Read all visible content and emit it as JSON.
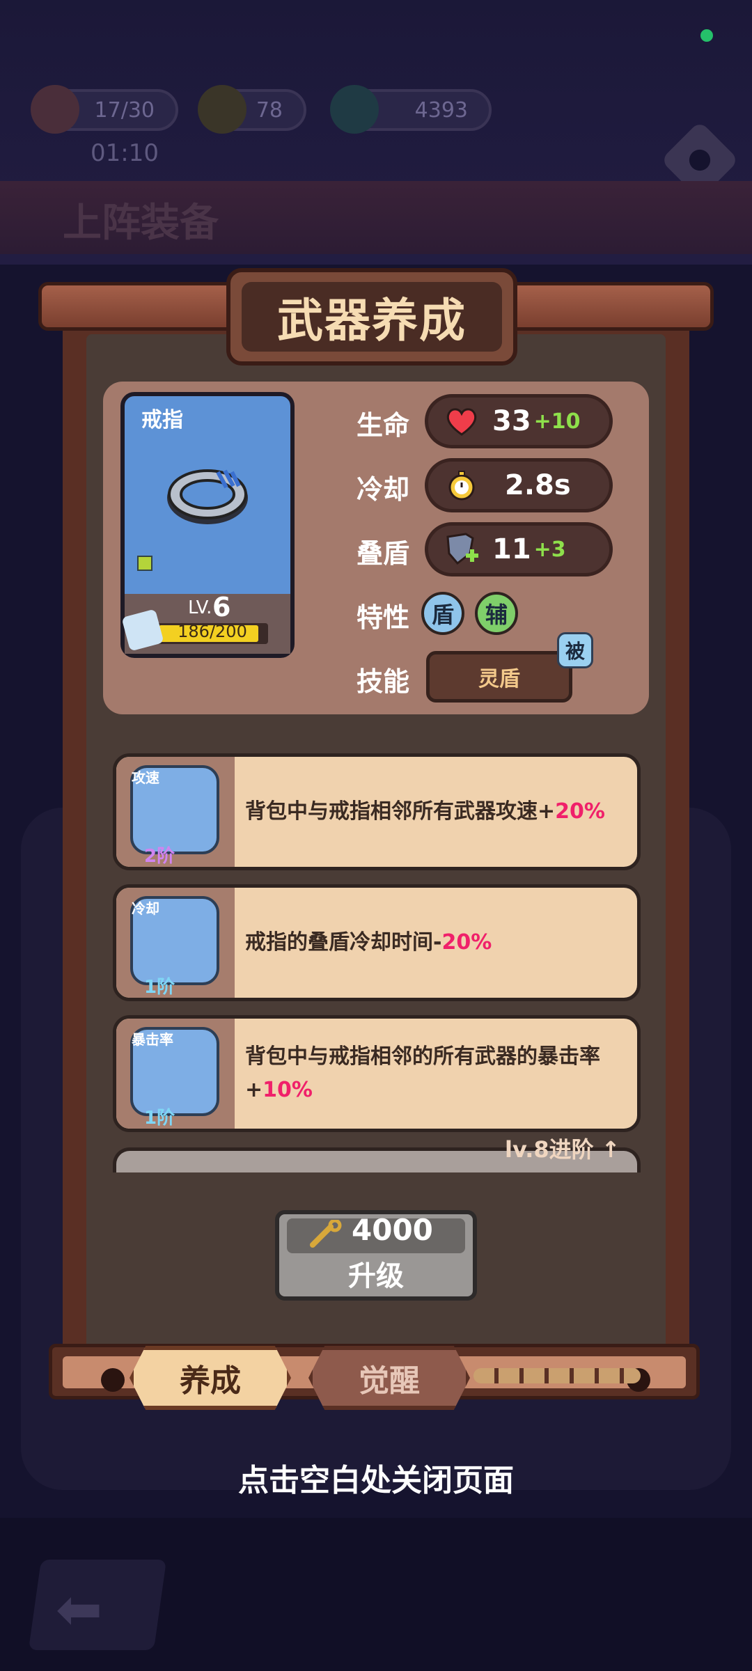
{
  "resources": {
    "stamina": "17/30",
    "keys": "78",
    "gems": "4393",
    "timer": "01:10"
  },
  "background": {
    "title": "上阵装备"
  },
  "panel": {
    "title": "武器养成"
  },
  "weapon": {
    "name": "戒指",
    "level_prefix": "LV.",
    "level": "6",
    "xp_text": "186/200",
    "xp_progress": 0.93
  },
  "stats": [
    {
      "label": "生命",
      "icon": "heart-icon",
      "value": "33",
      "bonus": "+10"
    },
    {
      "label": "冷却",
      "icon": "stopwatch-icon",
      "value": "2.8s",
      "bonus": ""
    },
    {
      "label": "叠盾",
      "icon": "shield-plus-icon",
      "value": "11",
      "bonus": "+3"
    }
  ],
  "traits": {
    "label": "特性",
    "items": [
      {
        "text": "盾",
        "color": "#8fc4ea"
      },
      {
        "text": "辅",
        "color": "#7fcf6a"
      }
    ]
  },
  "skill": {
    "label": "技能",
    "name": "灵盾",
    "badge": "被"
  },
  "upgrades": [
    {
      "tag": "攻速",
      "rank": "2阶",
      "rank_color": "#d084f0",
      "text_main": "背包中与戒指相邻所有武器攻速+",
      "text_highlight": "20%"
    },
    {
      "tag": "冷却",
      "rank": "1阶",
      "rank_color": "#7fd6f5",
      "text_main": "戒指的叠盾冷却时间-",
      "text_highlight": "20%"
    },
    {
      "tag": "暴击率",
      "rank": "1阶",
      "rank_color": "#7fd6f5",
      "text_main": "背包中与戒指相邻的所有武器的暴击率+",
      "text_highlight": "10%"
    }
  ],
  "advance_hint": "lv.8进阶",
  "upgrade_button": {
    "cost": "4000",
    "label": "升级"
  },
  "tabs": [
    {
      "label": "养成",
      "active": true
    },
    {
      "label": "觉醒",
      "active": false
    }
  ],
  "close_hint": "点击空白处关闭页面",
  "colors": {
    "highlight": "#f0206a",
    "bonus": "#8ee04b",
    "status_dot": "#25c06a"
  }
}
